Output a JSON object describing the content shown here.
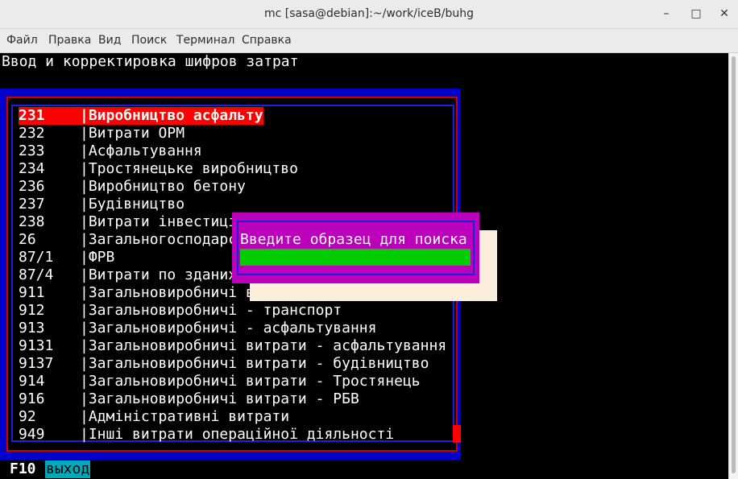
{
  "window": {
    "title": "mc [sasa@debian]:~/work/iceB/buhg",
    "controls": [
      "–",
      "□",
      "✕"
    ]
  },
  "menu": [
    "Файл",
    "Правка",
    "Вид",
    "Поиск",
    "Терминал",
    "Справка"
  ],
  "screen": {
    "heading": "Ввод и корректировка шифров затрат"
  },
  "list": {
    "rows": [
      {
        "code": "231",
        "name": "Виробництво асфальту"
      },
      {
        "code": "232",
        "name": "Витрати ОРМ"
      },
      {
        "code": "233",
        "name": "Асфальтування"
      },
      {
        "code": "234",
        "name": "Тростянецьке виробництво"
      },
      {
        "code": "236",
        "name": "Виробництво бетону"
      },
      {
        "code": "237",
        "name": "Будівництво"
      },
      {
        "code": "238",
        "name": "Витрати інвестиці"
      },
      {
        "code": "26",
        "name": "Загальногосподарс"
      },
      {
        "code": "87/1",
        "name": "ФРВ"
      },
      {
        "code": "87/4",
        "name": "Витрати по зданих"
      },
      {
        "code": "911",
        "name": "Загальновиробничі в"
      },
      {
        "code": "912",
        "name": "Загальновиробничі - транспорт"
      },
      {
        "code": "913",
        "name": "Загальновиробничі - асфальтування"
      },
      {
        "code": "9131",
        "name": "Загальновиробничі витрати - асфальтування"
      },
      {
        "code": "9137",
        "name": "Загальновиробничі витрати - будівництво"
      },
      {
        "code": "914",
        "name": "Загальновиробничі витрати - Тростянець"
      },
      {
        "code": "916",
        "name": "Загальновиробничі витрати - РБВ"
      },
      {
        "code": "92",
        "name": "Адміністративні витрати"
      },
      {
        "code": "949",
        "name": "Інші витрати операційної діяльності"
      }
    ],
    "separator": "|"
  },
  "search_dialog": {
    "prompt": "Введите образец для поиска",
    "value": ""
  },
  "footer": {
    "key": "F10",
    "label": "выход"
  },
  "colors": {
    "terminal_bg": "#000000",
    "frame_blue": "#0000cc",
    "frame_red": "#cc0000",
    "selection": "#ff0000",
    "dialog": "#bb00bb",
    "input": "#00cc00",
    "footer_label": "#00aabb"
  }
}
